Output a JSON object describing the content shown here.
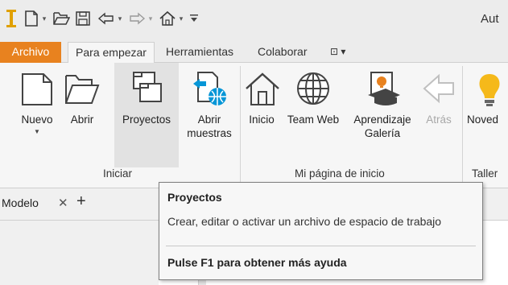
{
  "quick_access": {
    "app_title": "Aut",
    "icons": [
      "inventor-logo-icon",
      "new-file-icon",
      "open-folder-icon",
      "save-icon",
      "undo-icon",
      "redo-icon",
      "home-icon",
      "customize-toolbar-icon"
    ],
    "logo_color": "#e0a000"
  },
  "ribbon_tabs": [
    {
      "label": "Archivo",
      "color": "#e8821f"
    },
    {
      "label": "Para empezar"
    },
    {
      "label": "Herramientas"
    },
    {
      "label": "Colaborar"
    },
    {
      "label": "⊡ ▾"
    }
  ],
  "ribbon": {
    "buttons": [
      {
        "label": "Nuevo",
        "icon": "new-document-icon"
      },
      {
        "label": "Abrir",
        "icon": "open-folder-icon"
      },
      {
        "label": "Proyectos",
        "icon": "projects-icon"
      },
      {
        "label": "Abrir\nmuestras",
        "icon": "open-samples-icon"
      },
      {
        "label": "Inicio",
        "icon": "home-icon"
      },
      {
        "label": "Team Web",
        "icon": "globe-icon"
      },
      {
        "label": "Aprendizaje\nGalería",
        "icon": "learning-gallery-icon"
      },
      {
        "label": "Atrás",
        "icon": "back-arrow-icon"
      },
      {
        "label": "Noved",
        "icon": "whats-new-icon"
      }
    ],
    "groups": [
      {
        "label": "Iniciar"
      },
      {
        "label": "Mi página de inicio"
      },
      {
        "label": "Taller"
      }
    ]
  },
  "browser": {
    "tab_label": "Modelo",
    "close_glyph": "✕",
    "add_glyph": "+"
  },
  "tooltip": {
    "title": "Proyectos",
    "description": "Crear, editar o activar un archivo de espacio de trabajo",
    "help": "Pulse F1 para obtener más ayuda"
  }
}
